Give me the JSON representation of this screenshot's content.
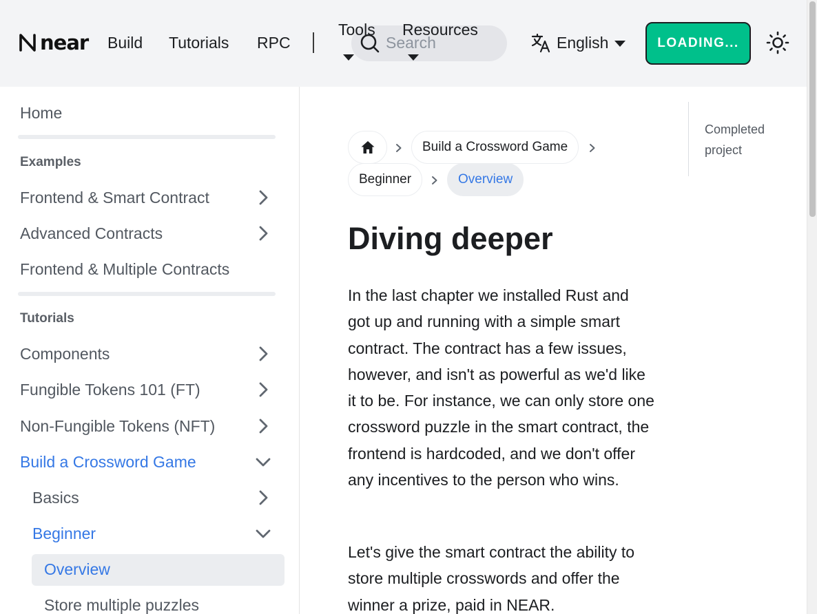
{
  "navbar": {
    "logo_text": "near",
    "links": {
      "build": "Build",
      "tutorials": "Tutorials",
      "rpc": "RPC",
      "tools": "Tools",
      "resources": "Resources"
    },
    "search": {
      "placeholder": "Search"
    },
    "language": "English",
    "login_label": "LOADING...",
    "icons": [
      "near-logo-icon",
      "search-icon",
      "translate-icon",
      "sun-icon",
      "caret-down-icon"
    ]
  },
  "sidebar": {
    "home": "Home",
    "examples": {
      "title": "Examples",
      "items": [
        "Frontend & Smart Contract",
        "Advanced Contracts",
        "Frontend & Multiple Contracts"
      ]
    },
    "tutorials": {
      "title": "Tutorials",
      "items": [
        "Components",
        "Fungible Tokens 101 (FT)",
        "Non-Fungible Tokens (NFT)",
        "Build a Crossword Game"
      ],
      "crossword": {
        "items": [
          "Basics",
          "Beginner"
        ],
        "beginner": {
          "items": [
            "Overview",
            "Store multiple puzzles"
          ]
        }
      }
    }
  },
  "breadcrumb": {
    "items": [
      "Build a Crossword Game",
      "Beginner",
      "Overview"
    ]
  },
  "article": {
    "title": "Diving deeper",
    "paragraphs": [
      "In the last chapter we installed Rust and got up and running with a simple smart contract. The contract has a few issues, however, and isn't as powerful as we'd like it to be. For instance, we can only store one crossword puzzle in the smart contract, the frontend is hardcoded, and we don't offer any incentives to the person who wins.",
      "Let's give the smart contract the ability to store multiple crosswords and offer the winner a prize, paid in NEAR."
    ]
  },
  "toc": {
    "items": [
      "Completed project"
    ]
  },
  "colors": {
    "accent": "#3578e5",
    "login_button": "#00c08b",
    "navbar_bg": "#f3f4f6"
  }
}
